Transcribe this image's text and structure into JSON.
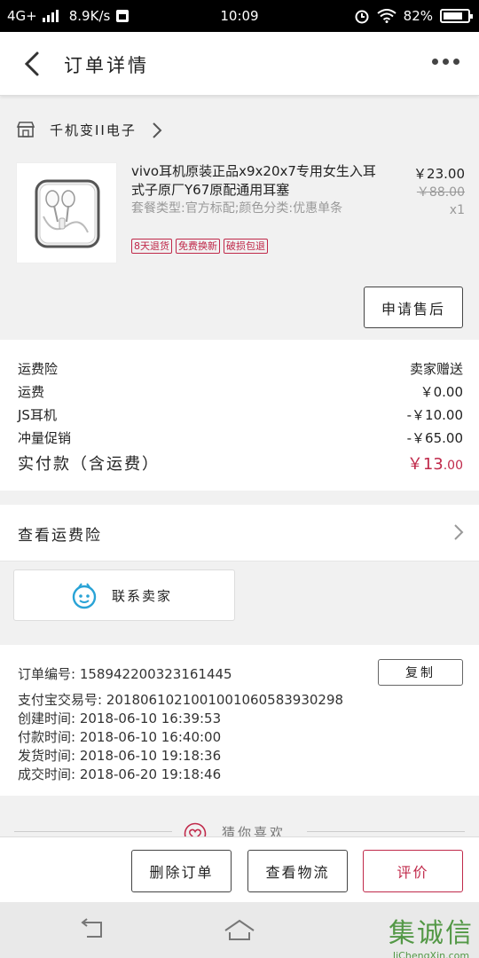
{
  "status_bar": {
    "network": "4G+",
    "speed": "8.9K/s",
    "time": "10:09",
    "battery_percent": 0.82,
    "battery": "82%"
  },
  "header": {
    "title": "订单详情"
  },
  "shop": {
    "name": "千机变II电子"
  },
  "product": {
    "title": "vivo耳机原装正品x9x20x7专用女生入耳式子原厂Y67原配通用耳塞",
    "spec": "套餐类型:官方标配;颜色分类:优惠单条",
    "tags": [
      "8天退货",
      "免费换新",
      "破损包退"
    ],
    "price": "￥23.00",
    "original_price": "￥88.00",
    "quantity": "x1",
    "after_sale_label": "申请售后"
  },
  "fees": {
    "rows": [
      {
        "label": "运费险",
        "value": "卖家赠送"
      },
      {
        "label": "运费",
        "value": "￥0.00"
      },
      {
        "label": "JS耳机",
        "value": "-￥10.00"
      },
      {
        "label": "冲量促销",
        "value": "-￥65.00"
      }
    ],
    "total_label": "实付款（含运费）",
    "total_currency": "￥",
    "total_int": "13",
    "total_dec": ".00"
  },
  "insurance": {
    "label": "查看运费险"
  },
  "contact": {
    "label": "联系卖家"
  },
  "order_info": {
    "copy_label": "复制",
    "rows": [
      "订单编号: 158942200323161445",
      "支付宝交易号: 2018061021001001060583930298",
      "创建时间: 2018-06-10 16:39:53",
      "付款时间: 2018-06-10 16:40:00",
      "发货时间: 2018-06-10 19:18:36",
      "成交时间: 2018-06-20 19:18:46"
    ]
  },
  "guess": {
    "label": "猜你喜欢"
  },
  "actions": {
    "delete_label": "删除订单",
    "logistics_label": "查看物流",
    "review_label": "评价"
  },
  "watermark": {
    "big": "集诚信",
    "small": "JiChengXin.com"
  },
  "colors": {
    "accent": "#c0294a",
    "contact_icon": "#29a3d6"
  }
}
